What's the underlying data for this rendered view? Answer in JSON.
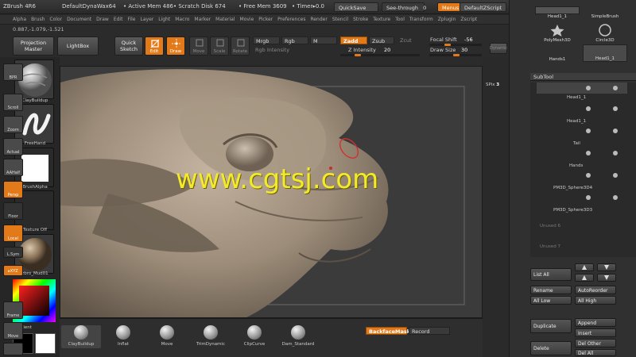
{
  "titlebar": {
    "app": "ZBrush 4R6",
    "document": "DefaultDynaWax64",
    "active_mem": "• Active Mem 486",
    "scratch_disk": "• Scratch Disk 674",
    "free_mem": "• Free Mem 3609",
    "timer": "• Timer▸0.0",
    "quicksave": "QuickSave",
    "see_through": "See-through",
    "see_through_value": "0",
    "menus": "Menus",
    "script": "DefaultZScript"
  },
  "menubar": [
    "Alpha",
    "Brush",
    "Color",
    "Document",
    "Draw",
    "Edit",
    "File",
    "Layer",
    "Light",
    "Macro",
    "Marker",
    "Material",
    "Movie",
    "Picker",
    "Preferences",
    "Render",
    "Stencil",
    "Stroke",
    "Texture",
    "Tool",
    "Transform",
    "Zplugin",
    "Zscript"
  ],
  "coords": "0.887,-1.079,-1.521",
  "toolbar": {
    "projection_master": "Projection Master",
    "lightbox": "LightBox",
    "quick_sketch": "Quick Sketch",
    "edit": "Edit",
    "draw": "Draw",
    "move": "Move",
    "scale": "Scale",
    "rotate": "Rotate",
    "mrgb": "Mrgb",
    "rgb": "Rgb",
    "m": "M",
    "rgb_intensity": "Rgb Intensity",
    "zadd": "Zadd",
    "zsub": "Zsub",
    "zcut": "Zcut",
    "z_intensity_label": "Z Intensity",
    "z_intensity_value": "20",
    "focal_shift_label": "Focal Shift",
    "focal_shift_value": "-56",
    "draw_size_label": "Draw Size",
    "draw_size_value": "30",
    "dynamic": "Dynamic"
  },
  "left_shelf": {
    "brush": "ClayBuildup",
    "stroke": "FreeHand",
    "alpha": "BrushAlpha",
    "texture": "Texture Off",
    "material": "zbro_Mud01",
    "gradient": "Gradient"
  },
  "canvas": {
    "watermark": "www.cgtsj.com"
  },
  "right_shelf": {
    "bpr": "BPR",
    "spix_label": "SPix",
    "spix_value": "3",
    "scroll": "Scroll",
    "zoom": "Zoom",
    "actual": "Actual",
    "aahalf": "AAHalf",
    "persp": "Persp",
    "floor": "Floor",
    "local": "Local",
    "lsym": "L.Sym",
    "xyz": "▸XYZ",
    "frame": "Frame",
    "move": "Move"
  },
  "bottom_brushes": [
    "ClayBuildup",
    "Inflat",
    "Move",
    "TrimDynamic",
    "ClipCurve",
    "Dam_Standard"
  ],
  "bottom_buttons": {
    "backface_mask": "BackfaceMask",
    "record": "Record"
  },
  "tray": {
    "tools": [
      "Head1_1",
      "SimpleBrush",
      "PolyMesh3D",
      "Circle3D",
      "Hands1",
      "Head1_1"
    ],
    "subtool_title": "SubTool",
    "subtools": [
      "Head1_1",
      "Head1_1",
      "Tail",
      "Hands",
      "PM3D_Sphere3D4",
      "PM3D_Sphere3D3"
    ],
    "unused": [
      "Unused 6",
      "Unused 7"
    ],
    "list_all": "List All",
    "rename": "Rename",
    "auto_reorder": "AutoReorder",
    "all_low": "All Low",
    "all_high": "All High",
    "duplicate": "Duplicate",
    "append": "Append",
    "insert": "Insert",
    "delete": "Delete",
    "del_other": "Del Other",
    "del_all": "Del All"
  }
}
